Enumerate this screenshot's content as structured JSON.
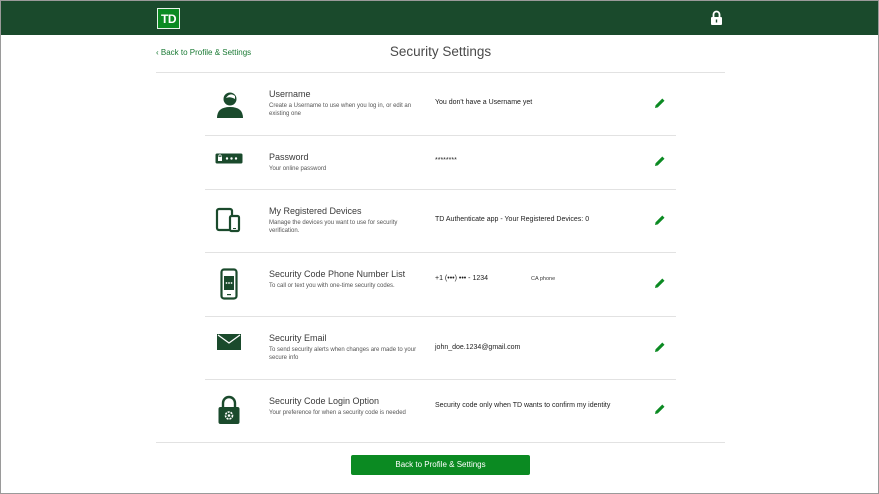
{
  "header": {
    "logo_text": "TD",
    "brand_color": "#1a4a2c",
    "accent_color": "#0b8a22",
    "lock_icon": "lock-icon"
  },
  "nav": {
    "back_label": "‹ Back to Profile & Settings"
  },
  "page": {
    "title": "Security Settings"
  },
  "rows": [
    {
      "icon": "user-icon",
      "title": "Username",
      "description": "Create a Username to use when you log in, or edit an existing one",
      "value": "You don't have a Username yet"
    },
    {
      "icon": "password-icon",
      "title": "Password",
      "description": "Your online password",
      "value": "********"
    },
    {
      "icon": "devices-icon",
      "title": "My Registered Devices",
      "description": "Manage the devices you want to use for security verification.",
      "value": "TD Authenticate app - Your Registered Devices: 0"
    },
    {
      "icon": "phone-icon",
      "title": "Security Code Phone Number List",
      "description": "To call or text you with one-time security codes.",
      "value": "+1 (•••) ••• - 1234",
      "extra": "CA phone"
    },
    {
      "icon": "email-icon",
      "title": "Security Email",
      "description": "To send security alerts when changes are made to your secure info",
      "value": "john_doe.1234@gmail.com"
    },
    {
      "icon": "security-lock-icon",
      "title": "Security Code Login Option",
      "description": "Your preference for when a security code is needed",
      "value": "Security code only when TD wants to confirm my identity"
    }
  ],
  "edit_icon": "pencil-icon",
  "footer": {
    "button_label": "Back to Profile & Settings"
  }
}
